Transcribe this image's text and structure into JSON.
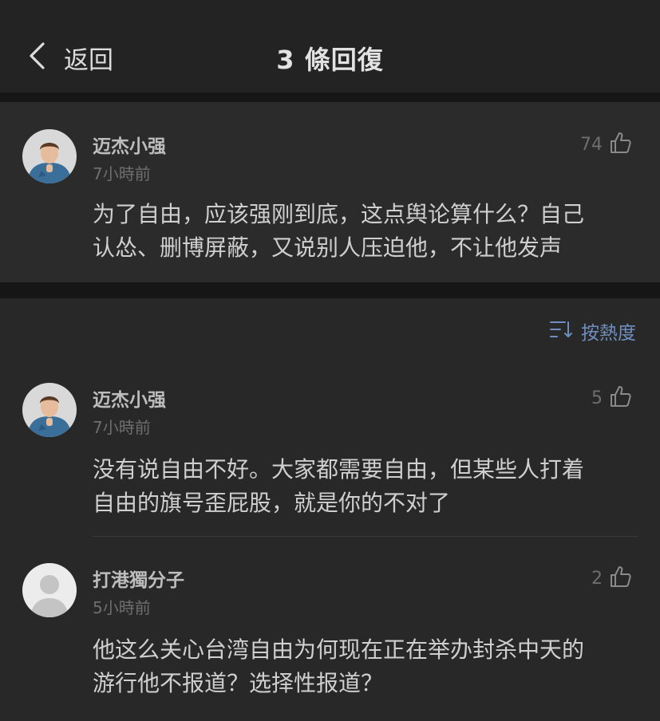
{
  "header": {
    "back_label": "返回",
    "title": "3 條回復"
  },
  "root_comment": {
    "username": "迈杰小强",
    "time": "7小時前",
    "likes": "74",
    "text_line1": "为了自由，应该强刚到底，这点舆论算什么？自己",
    "text_line2": "认怂、删博屏蔽，又说别人压迫他，不让他发声"
  },
  "sort": {
    "label": "按熱度",
    "icon": "sort-icon"
  },
  "replies": [
    {
      "username": "迈杰小强",
      "time": "7小時前",
      "likes": "5",
      "text_line1": "没有说自由不好。大家都需要自由，但某些人打着",
      "text_line2": "自由的旗号歪屁股，就是你的不对了"
    },
    {
      "username": "打港獨分子",
      "time": "5小時前",
      "likes": "2",
      "text_line1": "他这么关心台湾自由为何现在正在举办封杀中天的",
      "text_line2": "游行他不报道？选择性报道？"
    }
  ],
  "colors": {
    "background": "#232323",
    "card": "#2b2b2b",
    "separator": "#161616",
    "accent": "#6f8fc0"
  }
}
